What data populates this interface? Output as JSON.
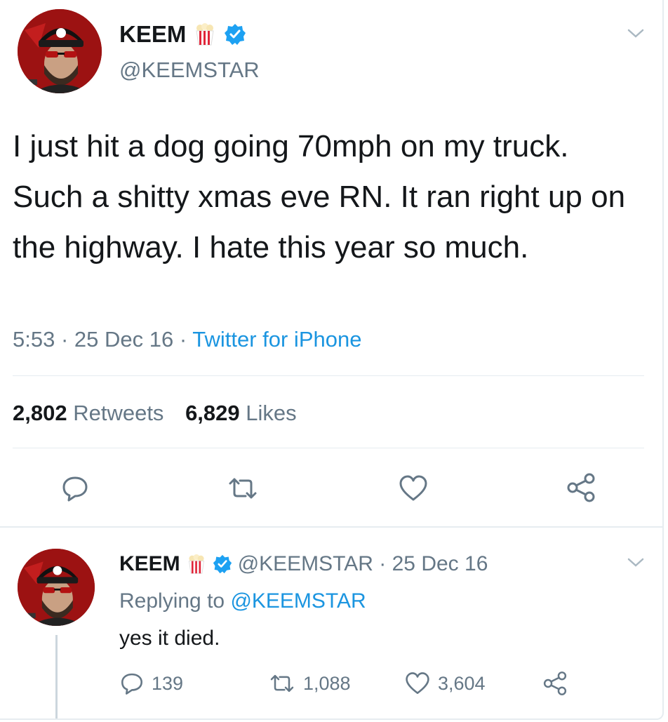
{
  "main_tweet": {
    "display_name": "KEEM",
    "handle": "@KEEMSTAR",
    "text": "I just hit a dog going 70mph on my truck. Such a shitty xmas eve RN. It ran right up on the highway. I hate this year so much.",
    "time": "5:53",
    "sep1": " · ",
    "date": "25 Dec 16",
    "sep2": " · ",
    "source": "Twitter for iPhone",
    "retweets_count": "2,802",
    "retweets_label": "Retweets",
    "likes_count": "6,829",
    "likes_label": "Likes"
  },
  "reply_tweet": {
    "display_name": "KEEM",
    "handle": "@KEEMSTAR",
    "sep": " · ",
    "date": "25 Dec 16",
    "replying_prefix": "Replying to",
    "replying_handle": "@KEEMSTAR",
    "text": "yes it died.",
    "reply_count": "139",
    "retweet_count": "1,088",
    "like_count": "3,604"
  },
  "icons": {
    "emoji": "popcorn-icon",
    "verified": "verified-badge-icon",
    "menu": "chevron-down-icon",
    "reply": "reply-icon",
    "retweet": "retweet-icon",
    "like": "heart-icon",
    "share": "share-icon"
  },
  "colors": {
    "text": "#14171a",
    "secondary": "#657786",
    "link": "#1b95e0",
    "verified": "#1da1f2",
    "divider": "#e6ecf0"
  }
}
